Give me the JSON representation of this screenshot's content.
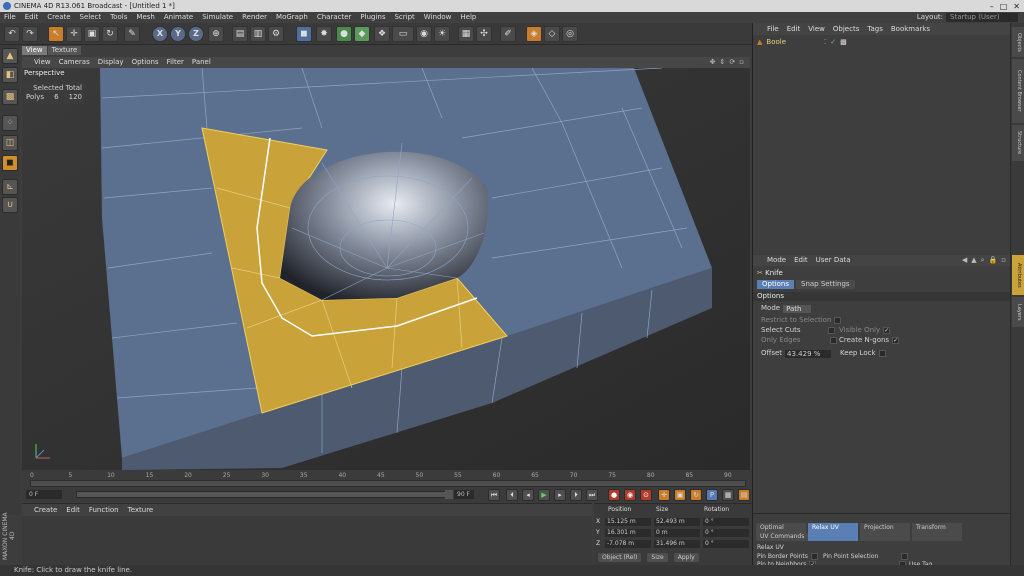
{
  "window": {
    "title": "CINEMA 4D R13.061 Broadcast - [Untitled 1 *]",
    "controls": [
      "–",
      "□",
      "✕"
    ]
  },
  "menubar": {
    "items": [
      "File",
      "Edit",
      "Create",
      "Select",
      "Tools",
      "Mesh",
      "Animate",
      "Simulate",
      "Render",
      "MoGraph",
      "Character",
      "Plugins",
      "Script",
      "Window",
      "Help"
    ],
    "layout_label": "Layout:",
    "layout_value": "Startup (User)"
  },
  "toolbar": {
    "icons": [
      "undo-icon",
      "redo-icon",
      "live-selection-icon",
      "move-icon",
      "scale-icon",
      "rotate-icon",
      "recent-tools-icon",
      "x-axis-icon",
      "y-axis-icon",
      "z-axis-icon",
      "coordinate-system-icon",
      "render-view-icon",
      "render-picture-viewer-icon",
      "edit-render-settings-icon",
      "cube-icon",
      "subdivision-icon",
      "array-icon",
      "sds-icon",
      "deformer-icon",
      "floor-icon",
      "camera-icon",
      "light-icon",
      "make-editable-icon",
      "points-mode-icon",
      "edges-mode-icon",
      "polygons-mode-icon"
    ],
    "axis_labels": [
      "X",
      "Y",
      "Z"
    ]
  },
  "viewport": {
    "tabs": [
      "View",
      "Texture"
    ],
    "menu": [
      "View",
      "Cameras",
      "Display",
      "Options",
      "Filter",
      "Panel"
    ],
    "camera_label": "Perspective",
    "hud": {
      "header": "Selected Total",
      "row_label": "Polys",
      "selected": "6",
      "total": "120"
    }
  },
  "timeline": {
    "ticks": [
      "0",
      "5",
      "10",
      "15",
      "20",
      "25",
      "30",
      "35",
      "40",
      "45",
      "50",
      "55",
      "60",
      "65",
      "70",
      "75",
      "80",
      "85",
      "90"
    ],
    "current_frame": "0 F",
    "start_frame": "0 F",
    "end_frame": "90 F",
    "range_end": "90 F"
  },
  "material_manager": {
    "menu": [
      "Create",
      "Edit",
      "Function",
      "Texture"
    ]
  },
  "coordinates": {
    "headers": [
      "Position",
      "Size",
      "Rotation"
    ],
    "rows": [
      {
        "axis": "X",
        "pos": "15.125 m",
        "size_axis": "X",
        "size": "52.493 m",
        "rot_axis": "H",
        "rot": "0 °"
      },
      {
        "axis": "Y",
        "pos": "16.301 m",
        "size_axis": "Y",
        "size": "0 m",
        "rot_axis": "P",
        "rot": "0 °"
      },
      {
        "axis": "Z",
        "pos": "-7.078 m",
        "size_axis": "Z",
        "size": "31.496 m",
        "rot_axis": "B",
        "rot": "0 °"
      }
    ],
    "mode": "Object (Rel)",
    "size_mode": "Size",
    "apply": "Apply"
  },
  "object_manager": {
    "menu": [
      "File",
      "Edit",
      "View",
      "Objects",
      "Tags",
      "Bookmarks"
    ],
    "object_name": "Boole"
  },
  "attribute_manager": {
    "menu": [
      "Mode",
      "Edit",
      "User Data"
    ],
    "tool_name": "Knife",
    "tabs": [
      "Options",
      "Snap Settings"
    ],
    "section": "Options",
    "mode_label": "Mode",
    "mode_value": "Path",
    "restrict": "Restrict to Selection",
    "select_cuts": "Select Cuts",
    "visible_only": "Visible Only",
    "only_edges": "Only Edges",
    "create_ngons": "Create N-gons",
    "offset_label": "Offset",
    "offset_value": "43.429 %",
    "keep_lock": "Keep Lock"
  },
  "uv_panel": {
    "tabs": [
      "Optimal Mapping",
      "Relax UV",
      "Projection",
      "Transform"
    ],
    "subtab": "UV Commands",
    "section": "Relax UV",
    "pin_border": "Pin Border Points",
    "pin_point_sel": "Pin Point Selection",
    "pin_neighbors": "Pin to Neighbors",
    "use_tag": "Use Tag"
  },
  "right_tabs": [
    "Objects",
    "Content Browser",
    "Structure",
    "Attributes",
    "Layers"
  ],
  "status": "Knife: Click to draw the knife line.",
  "branding": "MAXON CINEMA 4D",
  "colors": {
    "selection": "#c9a23a",
    "mesh": "#5a6f8e",
    "active_tab": "#5a7fb5",
    "accent": "#d08f2a"
  }
}
